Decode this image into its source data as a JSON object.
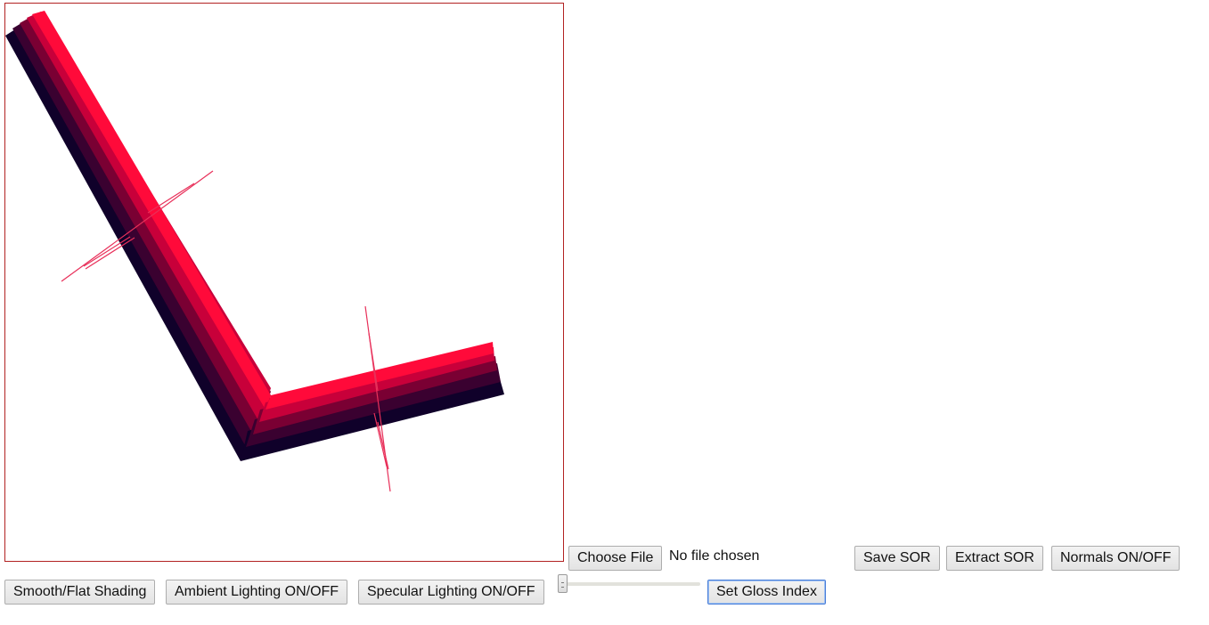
{
  "file_input": {
    "button_label": "Choose File",
    "status_text": "No file chosen"
  },
  "toolbar_top": {
    "save_label": "Save SOR",
    "extract_label": "Extract SOR",
    "normals_label": "Normals ON/OFF"
  },
  "toolbar_bottom": {
    "shading_label": "Smooth/Flat Shading",
    "ambient_label": "Ambient Lighting ON/OFF",
    "specular_label": "Specular Lighting ON/OFF",
    "gloss_label": "Set Gloss Index"
  },
  "gloss_slider": {
    "value_fraction": 0
  },
  "canvas": {
    "border_color": "#b22222",
    "palette": {
      "bright": "#ff0a3a",
      "mid": "#c8003a",
      "dark": "#7a0033",
      "darker": "#3a0130",
      "darkest": "#10012a",
      "normal_line": "#e8305a"
    }
  }
}
